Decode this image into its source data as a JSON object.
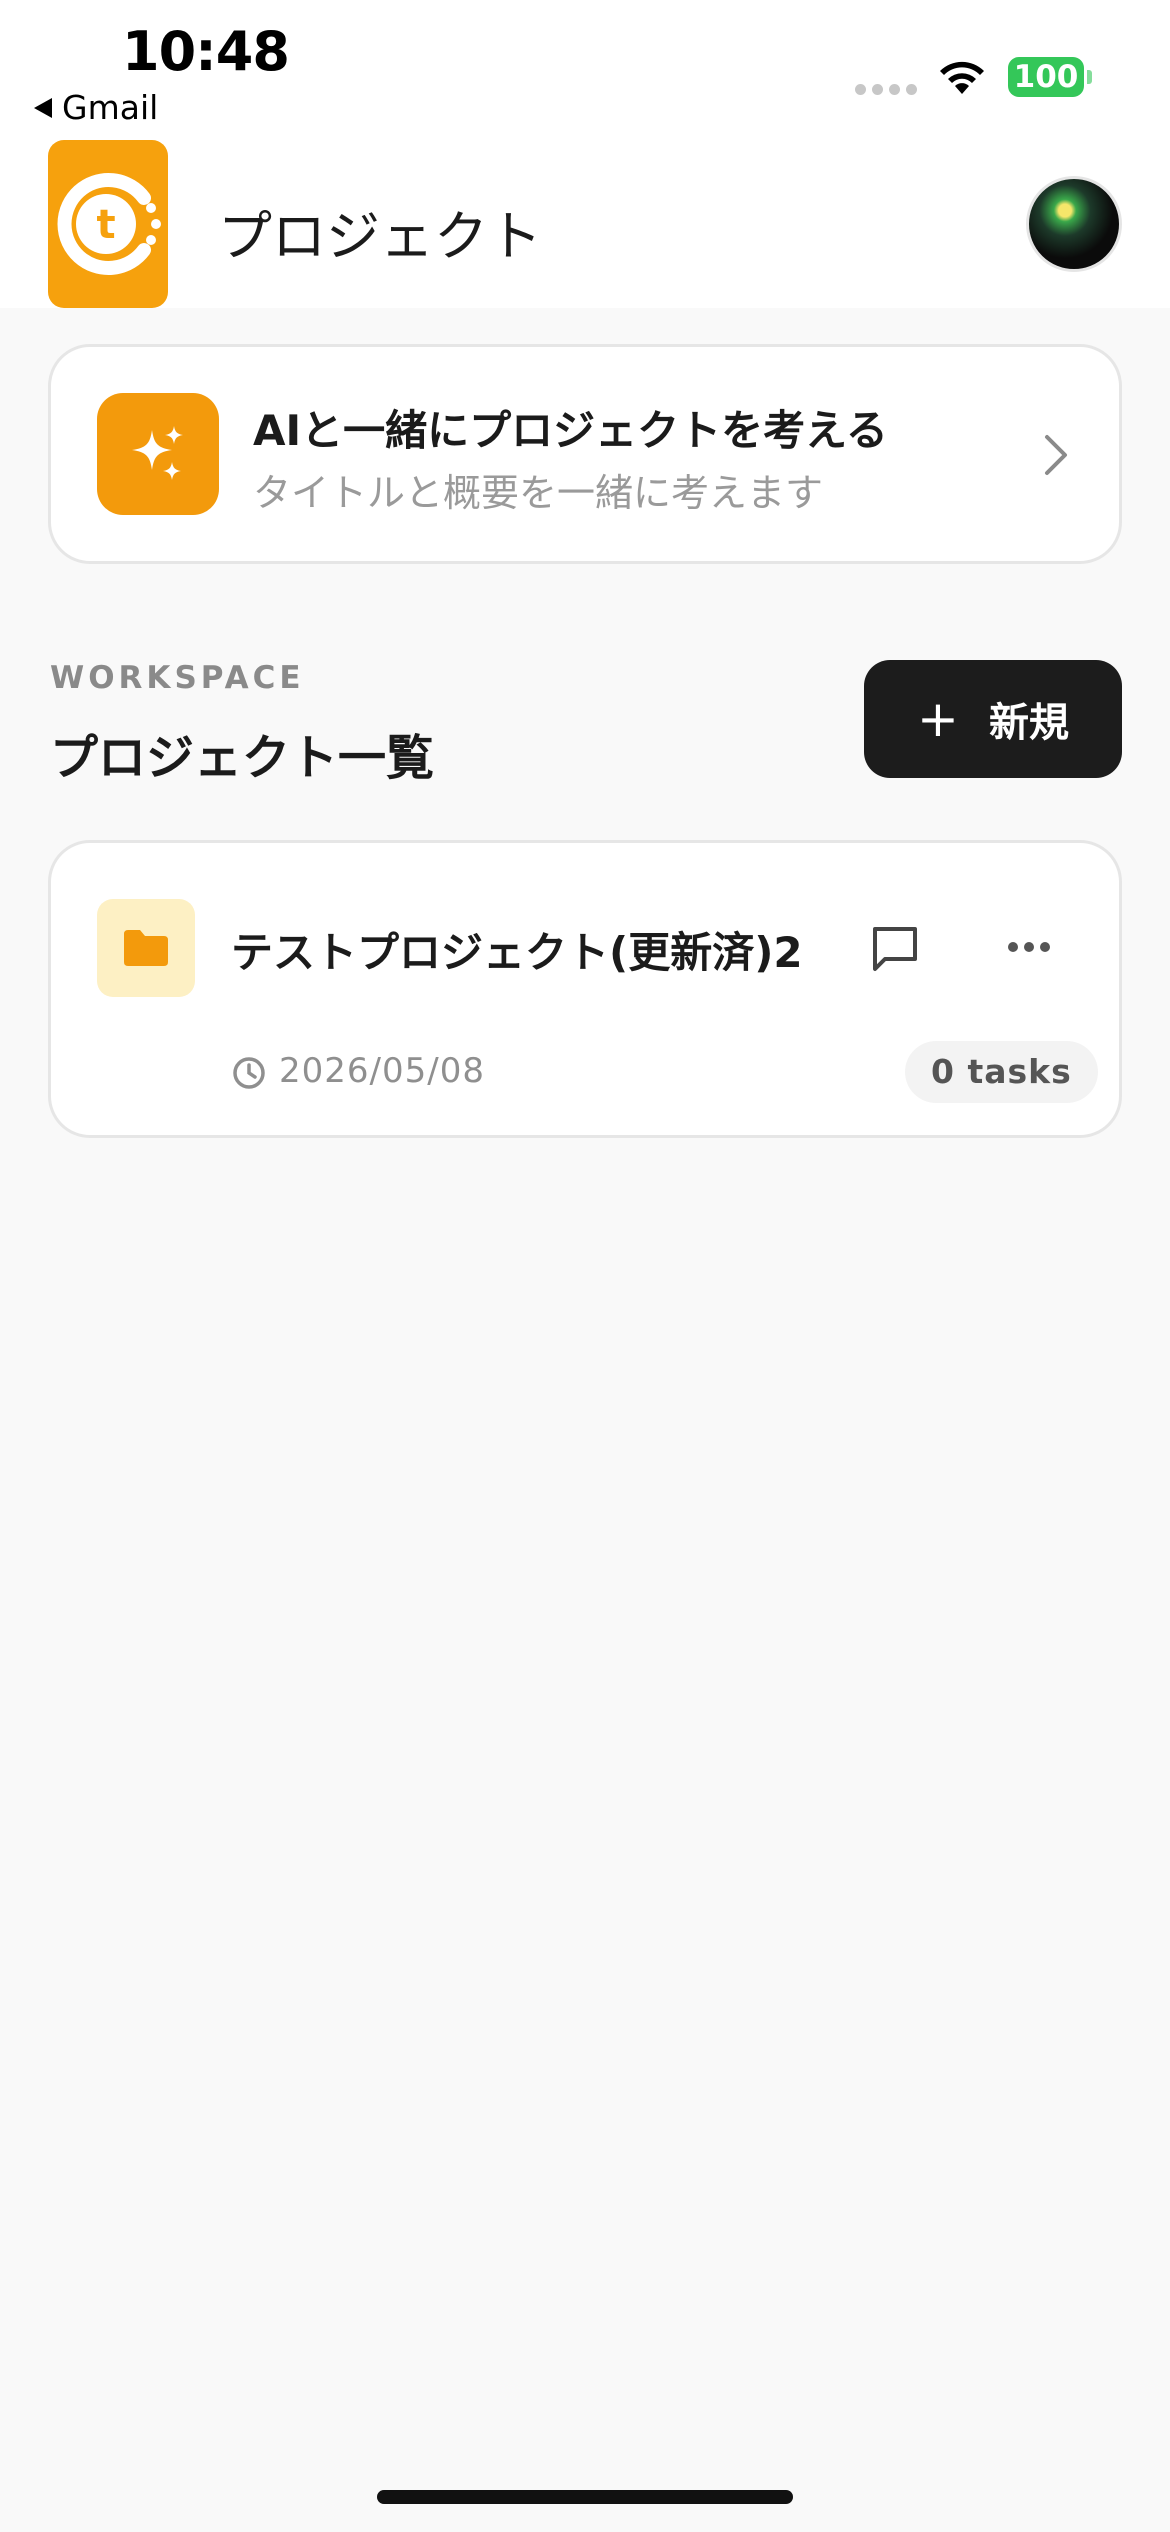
{
  "status_bar": {
    "time": "10:48",
    "back_label": "Gmail",
    "battery": "100",
    "battery_color": "#34c759"
  },
  "header": {
    "title": "プロジェクト",
    "logo_icon": "app-logo-icon",
    "avatar_icon": "user-avatar"
  },
  "ai_card": {
    "title": "AIと一緒にプロジェクトを考える",
    "subtitle": "タイトルと概要を一緒に考えます",
    "icon": "sparkles-icon",
    "accent": "#f39a0c"
  },
  "section": {
    "eyebrow": "WORKSPACE",
    "title": "プロジェクト一覧",
    "new_button_label": "新規",
    "new_button_icon": "plus-icon"
  },
  "projects": [
    {
      "name": "テストプロジェクト(更新済)2",
      "date": "2026/05/08",
      "tasks": "0 tasks",
      "icon": "folder-icon",
      "folder_color": "#f39a0c"
    }
  ]
}
